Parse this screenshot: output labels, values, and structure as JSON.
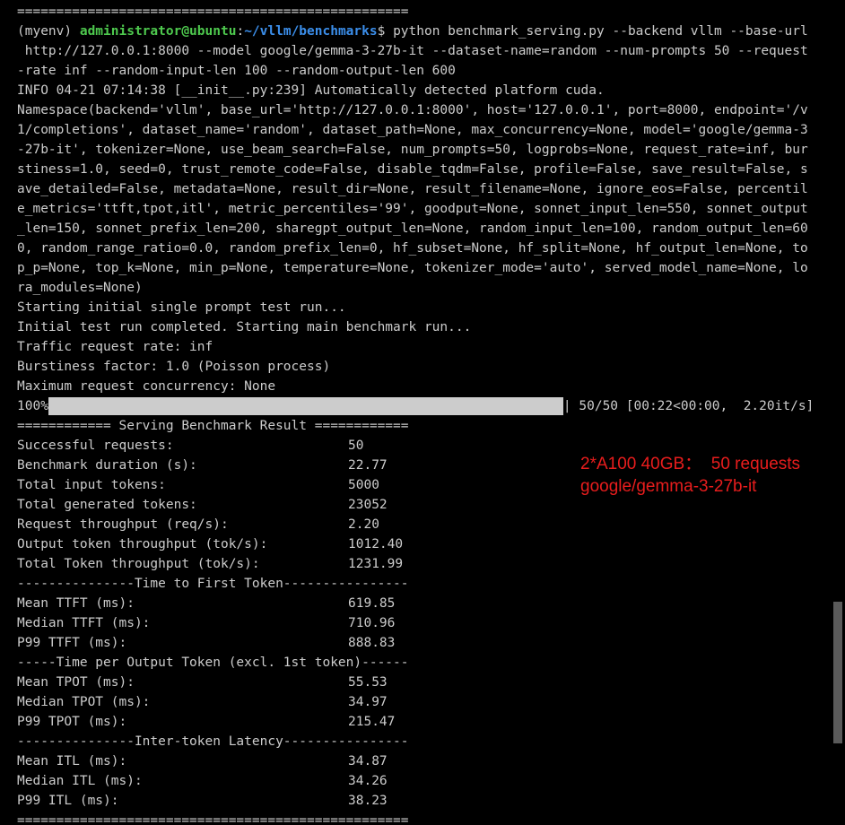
{
  "terminal": {
    "top_rule": "==================================================",
    "prompt": {
      "env": "(myenv) ",
      "user": "administrator@ubuntu",
      "sep": ":",
      "path": "~/vllm/benchmarks",
      "symbol": "$ ",
      "command": "python benchmark_serving.py --backend vllm --base-url"
    },
    "command_cont": [
      " http://127.0.0.1:8000 --model google/gemma-3-27b-it --dataset-name=random --num-prompts 50 --request",
      "-rate inf --random-input-len 100 --random-output-len 600"
    ],
    "log_lines": [
      "INFO 04-21 07:14:38 [__init__.py:239] Automatically detected platform cuda.",
      "Namespace(backend='vllm', base_url='http://127.0.0.1:8000', host='127.0.0.1', port=8000, endpoint='/v",
      "1/completions', dataset_name='random', dataset_path=None, max_concurrency=None, model='google/gemma-3",
      "-27b-it', tokenizer=None, use_beam_search=False, num_prompts=50, logprobs=None, request_rate=inf, bur",
      "stiness=1.0, seed=0, trust_remote_code=False, disable_tqdm=False, profile=False, save_result=False, s",
      "ave_detailed=False, metadata=None, result_dir=None, result_filename=None, ignore_eos=False, percentil",
      "e_metrics='ttft,tpot,itl', metric_percentiles='99', goodput=None, sonnet_input_len=550, sonnet_output",
      "_len=150, sonnet_prefix_len=200, sharegpt_output_len=None, random_input_len=100, random_output_len=60",
      "0, random_range_ratio=0.0, random_prefix_len=0, hf_subset=None, hf_split=None, hf_output_len=None, to",
      "p_p=None, top_k=None, min_p=None, temperature=None, tokenizer_mode='auto', served_model_name=None, lo",
      "ra_modules=None)",
      "Starting initial single prompt test run...",
      "Initial test run completed. Starting main benchmark run...",
      "Traffic request rate: inf",
      "Burstiness factor: 1.0 (Poisson process)",
      "Maximum request concurrency: None"
    ],
    "progress": {
      "percent_label": "100%",
      "fraction": 1.0,
      "stats": "| 50/50 [00:22<00:00,  2.20it/s]"
    },
    "result_header": "============ Serving Benchmark Result ============",
    "summary": [
      {
        "key": "Successful requests:",
        "value": "50"
      },
      {
        "key": "Benchmark duration (s):",
        "value": "22.77"
      },
      {
        "key": "Total input tokens:",
        "value": "5000"
      },
      {
        "key": "Total generated tokens:",
        "value": "23052"
      },
      {
        "key": "Request throughput (req/s):",
        "value": "2.20"
      },
      {
        "key": "Output token throughput (tok/s):",
        "value": "1012.40"
      },
      {
        "key": "Total Token throughput (tok/s):",
        "value": "1231.99"
      }
    ],
    "ttft_header": "---------------Time to First Token----------------",
    "ttft": [
      {
        "key": "Mean TTFT (ms):",
        "value": "619.85"
      },
      {
        "key": "Median TTFT (ms):",
        "value": "710.96"
      },
      {
        "key": "P99 TTFT (ms):",
        "value": "888.83"
      }
    ],
    "tpot_header": "-----Time per Output Token (excl. 1st token)------",
    "tpot": [
      {
        "key": "Mean TPOT (ms):",
        "value": "55.53"
      },
      {
        "key": "Median TPOT (ms):",
        "value": "34.97"
      },
      {
        "key": "P99 TPOT (ms):",
        "value": "215.47"
      }
    ],
    "itl_header": "---------------Inter-token Latency----------------",
    "itl": [
      {
        "key": "Mean ITL (ms):",
        "value": "34.87"
      },
      {
        "key": "Median ITL (ms):",
        "value": "34.26"
      },
      {
        "key": "P99 ITL (ms):",
        "value": "38.23"
      }
    ],
    "bottom_rule": "=================================================="
  },
  "annotation": {
    "line1": "2*A100 40GB：  50 requests",
    "line2": "google/gemma-3-27b-it",
    "color": "#e81d1d"
  },
  "colors": {
    "background": "#000000",
    "text": "#cccccc",
    "user": "#4ec94e",
    "path": "#3b8eea"
  }
}
